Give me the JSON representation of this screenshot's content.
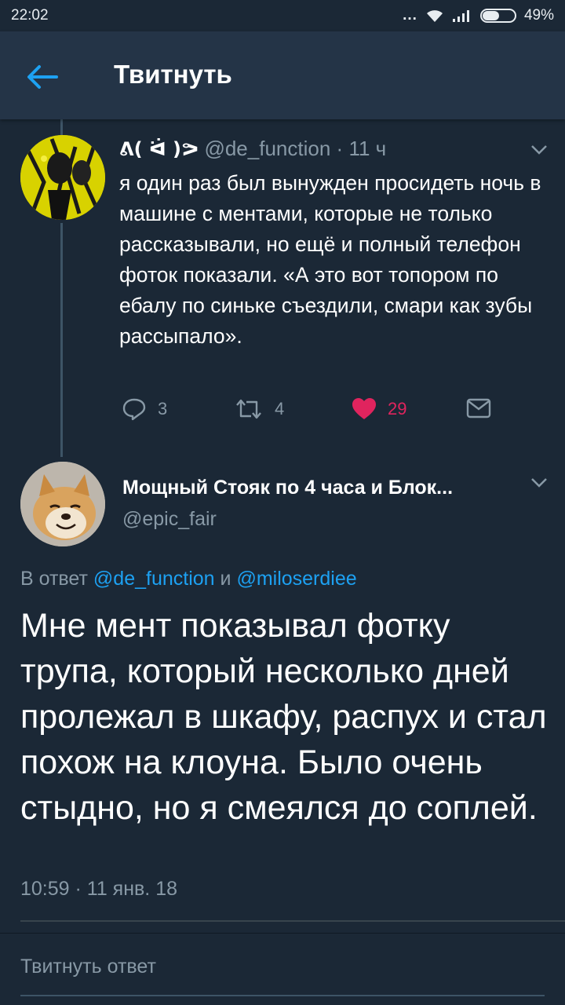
{
  "status_bar": {
    "time": "22:02",
    "dots": "...",
    "battery": "49%",
    "battery_level": 0.49
  },
  "header": {
    "title": "Твитнуть",
    "back_icon": "arrow-left-icon"
  },
  "parent_tweet": {
    "display_name": "ᕕ( ᐛ )ᕗ",
    "handle": "@de_function",
    "separator": "·",
    "time_ago": "11 ч",
    "text": "я один раз был вынужден просидеть ночь в машине с ментами, которые не только рассказывали, но ещё и полный телефон фоток показали. «А это вот топором по ебалу по синьке съездили, смари как зубы рассыпало».",
    "actions": {
      "reply_count": "3",
      "retweet_count": "4",
      "like_count": "29"
    }
  },
  "main_tweet": {
    "display_name": "Мощный Стояк по 4 часа и Блок...",
    "handle": "@epic_fair",
    "reply_prefix": "В ответ",
    "reply_mention_1": "@de_function",
    "reply_conj": "и",
    "reply_mention_2": "@miloserdiee",
    "text": "Мне мент показывал фотку трупа, который несколько дней пролежал в шкафу, распух и стал похож на клоуна. Было очень стыдно, но я смеялся до соплей.",
    "timestamp": "10:59 · 11 янв. 18"
  },
  "compose": {
    "placeholder": "Твитнуть ответ"
  },
  "colors": {
    "background": "#1b2836",
    "header": "#243447",
    "accent": "#1da1f2",
    "like": "#e0245e",
    "muted": "#8899a6"
  }
}
